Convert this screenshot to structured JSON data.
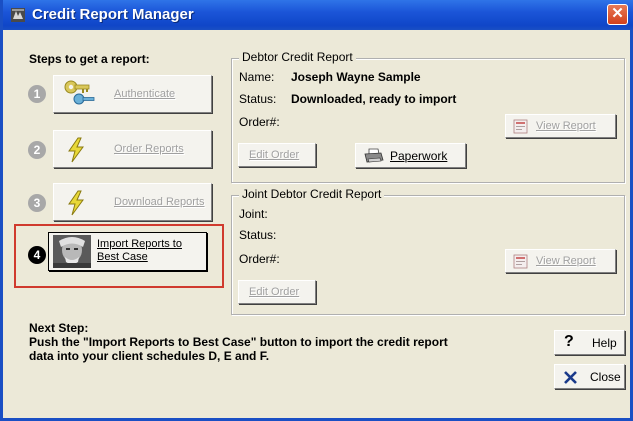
{
  "window": {
    "title": "Credit Report Manager",
    "close_glyph": "✕"
  },
  "steps": {
    "heading": "Steps to get a report:",
    "items": [
      {
        "number": "1",
        "label": "Authenticate",
        "icon": "key-icon",
        "enabled": false
      },
      {
        "number": "2",
        "label": "Order Reports",
        "icon": "lightning-icon",
        "enabled": false
      },
      {
        "number": "3",
        "label": "Download Reports",
        "icon": "lightning-icon",
        "enabled": false
      },
      {
        "number": "4",
        "label_line1": "Import Reports to",
        "label_line2": "Best Case",
        "icon": "portrait-icon",
        "enabled": true
      }
    ]
  },
  "debtor": {
    "group_title": "Debtor Credit Report",
    "name_label": "Name:",
    "name_value": "Joseph Wayne Sample",
    "status_label": "Status:",
    "status_value": "Downloaded, ready to import",
    "order_label": "Order#:",
    "edit_order": "Edit Order",
    "paperwork": "Paperwork",
    "view_report": "View Report"
  },
  "joint": {
    "group_title": "Joint Debtor Credit Report",
    "joint_label": "Joint:",
    "status_label": "Status:",
    "order_label": "Order#:",
    "edit_order": "Edit Order",
    "view_report": "View Report"
  },
  "next_step": {
    "heading": "Next Step:",
    "line1": "Push the \"Import Reports to Best Case\" button to import the credit report",
    "line2": "data into your client schedules D, E and F."
  },
  "actions": {
    "help": "Help",
    "close": "Close"
  },
  "colors": {
    "titlebar": "#1b55d8",
    "dialog_bg": "#ece9d8",
    "highlight_frame": "#d03a2e"
  }
}
